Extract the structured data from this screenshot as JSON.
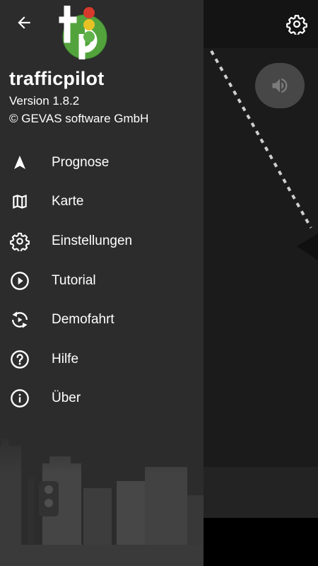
{
  "drawer": {
    "app_name": "trafficpilot",
    "version": "Version 1.8.2",
    "copyright": "© GEVAS software GmbH",
    "logo_text": "tp",
    "items": [
      {
        "label": "Prognose",
        "icon": "navigation-arrow-icon"
      },
      {
        "label": "Karte",
        "icon": "map-icon"
      },
      {
        "label": "Einstellungen",
        "icon": "gear-icon"
      },
      {
        "label": "Tutorial",
        "icon": "play-circle-icon"
      },
      {
        "label": "Demofahrt",
        "icon": "replay-icon"
      },
      {
        "label": "Hilfe",
        "icon": "help-circle-icon"
      },
      {
        "label": "Über",
        "icon": "info-circle-icon"
      }
    ]
  },
  "colors": {
    "drawer_bg": "#2c2c2c",
    "map_bg": "#1b1b1b",
    "logo_green": "#53a33d",
    "signal_red": "#d63a2c",
    "signal_yellow": "#e7c224",
    "signal_green": "#5fb24a"
  }
}
